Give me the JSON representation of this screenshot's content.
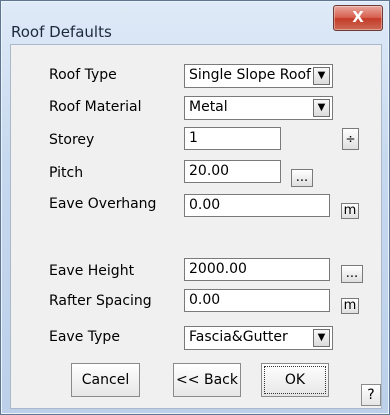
{
  "window": {
    "title": "Roof Defaults",
    "close_label": "X"
  },
  "fields": {
    "roof_type": {
      "label": "Roof Type",
      "value": "Single Slope Roof"
    },
    "roof_material": {
      "label": "Roof Material",
      "value": "Metal"
    },
    "storey": {
      "label": "Storey",
      "value": "1"
    },
    "pitch": {
      "label": "Pitch",
      "value": "20.00"
    },
    "eave_overhang": {
      "label": "Eave Overhang",
      "value": "0.00",
      "unit": "m"
    },
    "eave_height": {
      "label": "Eave Height",
      "value": "2000.00"
    },
    "rafter_spacing": {
      "label": "Rafter Spacing",
      "value": "0.00",
      "unit": "m"
    },
    "eave_type": {
      "label": "Eave Type",
      "value": "Fascia&Gutter"
    }
  },
  "buttons": {
    "cancel": "Cancel",
    "back": "<< Back",
    "ok": "OK",
    "help": "?",
    "ellipsis": "...",
    "spinner": "÷"
  }
}
